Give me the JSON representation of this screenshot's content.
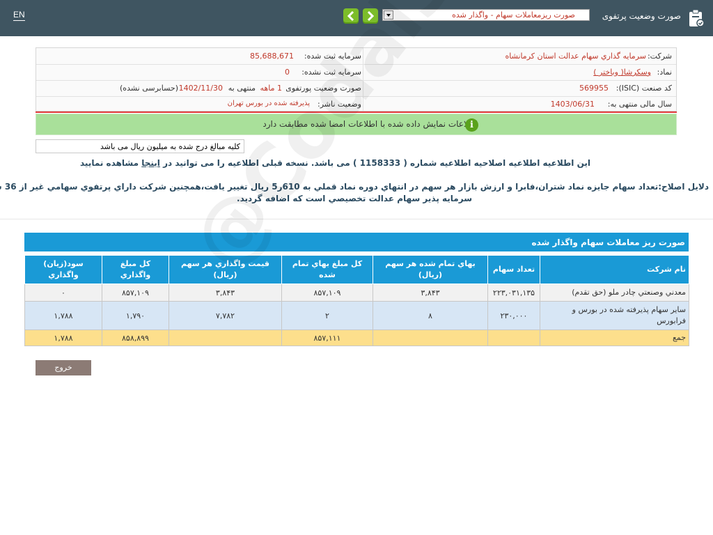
{
  "header": {
    "lang_link": "EN",
    "title": "صورت وضعیت پرتفوی",
    "report_select_value": "صورت ریزمعاملات سهام - واگذار شده"
  },
  "info": {
    "company_label": "شرکت:",
    "company_value": "سرمايه گذاري سهام عدالت استان کرمانشاه",
    "registered_capital_label": "سرمایه ثبت شده:",
    "registered_capital_value": "85,688,671",
    "symbol_label": "نماد:",
    "symbol_value": "وسکرشا( وباختر )",
    "unregistered_capital_label": "سرمایه ثبت نشده:",
    "unregistered_capital_value": "0",
    "isic_label": "کد صنعت (ISIC):",
    "isic_value": "569955",
    "portfolio_label": "صورت وضعیت پورتفوی",
    "portfolio_period": "1 ماهه",
    "portfolio_ending": "منتهی به",
    "portfolio_date": "1402/11/30",
    "portfolio_audit": "(حسابرسی نشده)",
    "fiscal_year_label": "سال مالی منتهی به:",
    "fiscal_year_value": "1403/06/31",
    "publisher_status_label": "وضعیت ناشر:",
    "publisher_status_value": "پذیرفته شده در بورس تهران"
  },
  "banner": {
    "message": "اطلاعات نمایش داده شده با اطلاعات امضا شده مطابقت دارد",
    "icon": "info-icon"
  },
  "units_note": "کلیه مبالغ درج شده به میلیون ریال می باشد",
  "notice": {
    "before_link": "این اطلاعیه اطلاعیه اصلاحیه اطلاعیه شماره ( 1158333 ) می باشد. نسخه قبلی اطلاعیه را می توانید در",
    "link": "اینجا",
    "after_link": "مشاهده نمایید"
  },
  "correction_reason": {
    "line1": "دلایل اصلاح:تعداد سهام جایزه نماد شتران،فابرا و ارزش بازار هر سهم در انتهاي دوره نماد قملي به 610ر5 ریال تغییر یافت،همچنین شرکت داراي پرتفوي سهامي غیر از 36 شرکت",
    "line2": "سرمایه پذیر سهام عدالت تخصیصي است که اضافه گردید."
  },
  "table": {
    "title": "صورت ريز معاملات سهام واگذار شده",
    "headers": [
      "نام شرکت",
      "تعداد سهام",
      "بهاي تمام شده هر سهم (ريال)",
      "کل مبلغ بهاي تمام شده",
      "قيمت واگذاري هر سهم (ريال)",
      "کل مبلغ واگذاري",
      "سود(زيان) واگذاري"
    ],
    "rows": [
      [
        "معدني وصنعتي چادر ملو (حق تقدم)",
        "۲۲۳,۰۳۱,۱۳۵",
        "۳,۸۴۳",
        "۸۵۷,۱۰۹",
        "۳,۸۴۳",
        "۸۵۷,۱۰۹",
        "۰"
      ],
      [
        "ساير سهام پذيرفته شده در بورس و فرابورس",
        "۲۳۰,۰۰۰",
        "۸",
        "۲",
        "۷,۷۸۲",
        "۱,۷۹۰",
        "۱,۷۸۸"
      ]
    ],
    "total": [
      "جمع",
      "",
      "",
      "۸۵۷,۱۱۱",
      "",
      "۸۵۸,۸۹۹",
      "۱,۷۸۸"
    ]
  },
  "exit_button": "خروج",
  "watermark": "@Codal360_ir",
  "colors": {
    "header_bg": "#3f5561",
    "table_blue": "#1a9ad6",
    "banner_green": "#a9e09a",
    "total_row": "#fddf8c",
    "value_red": "#c0392b"
  }
}
